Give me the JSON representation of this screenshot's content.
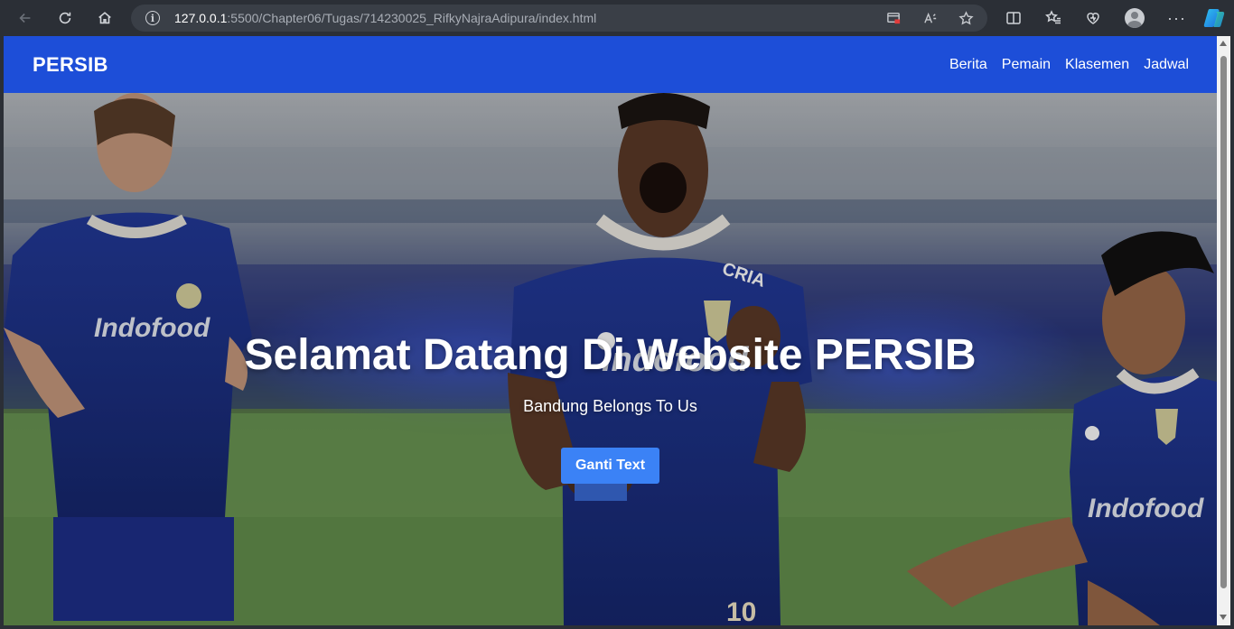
{
  "browser": {
    "url_host": "127.0.0.1",
    "url_rest": ":5500/Chapter06/Tugas/714230025_RifkyNajraAdipura/index.html"
  },
  "site": {
    "logo": "PERSIB",
    "nav": [
      "Berita",
      "Pemain",
      "Klasemen",
      "Jadwal"
    ]
  },
  "hero": {
    "title": "Selamat Datang Di Website PERSIB",
    "subtitle": "Bandung Belongs To Us",
    "button_label": "Ganti Text"
  },
  "colors": {
    "header_bg": "#1d4ed8",
    "button_bg": "#3b82f6",
    "chrome_bg": "#2b2f36"
  }
}
